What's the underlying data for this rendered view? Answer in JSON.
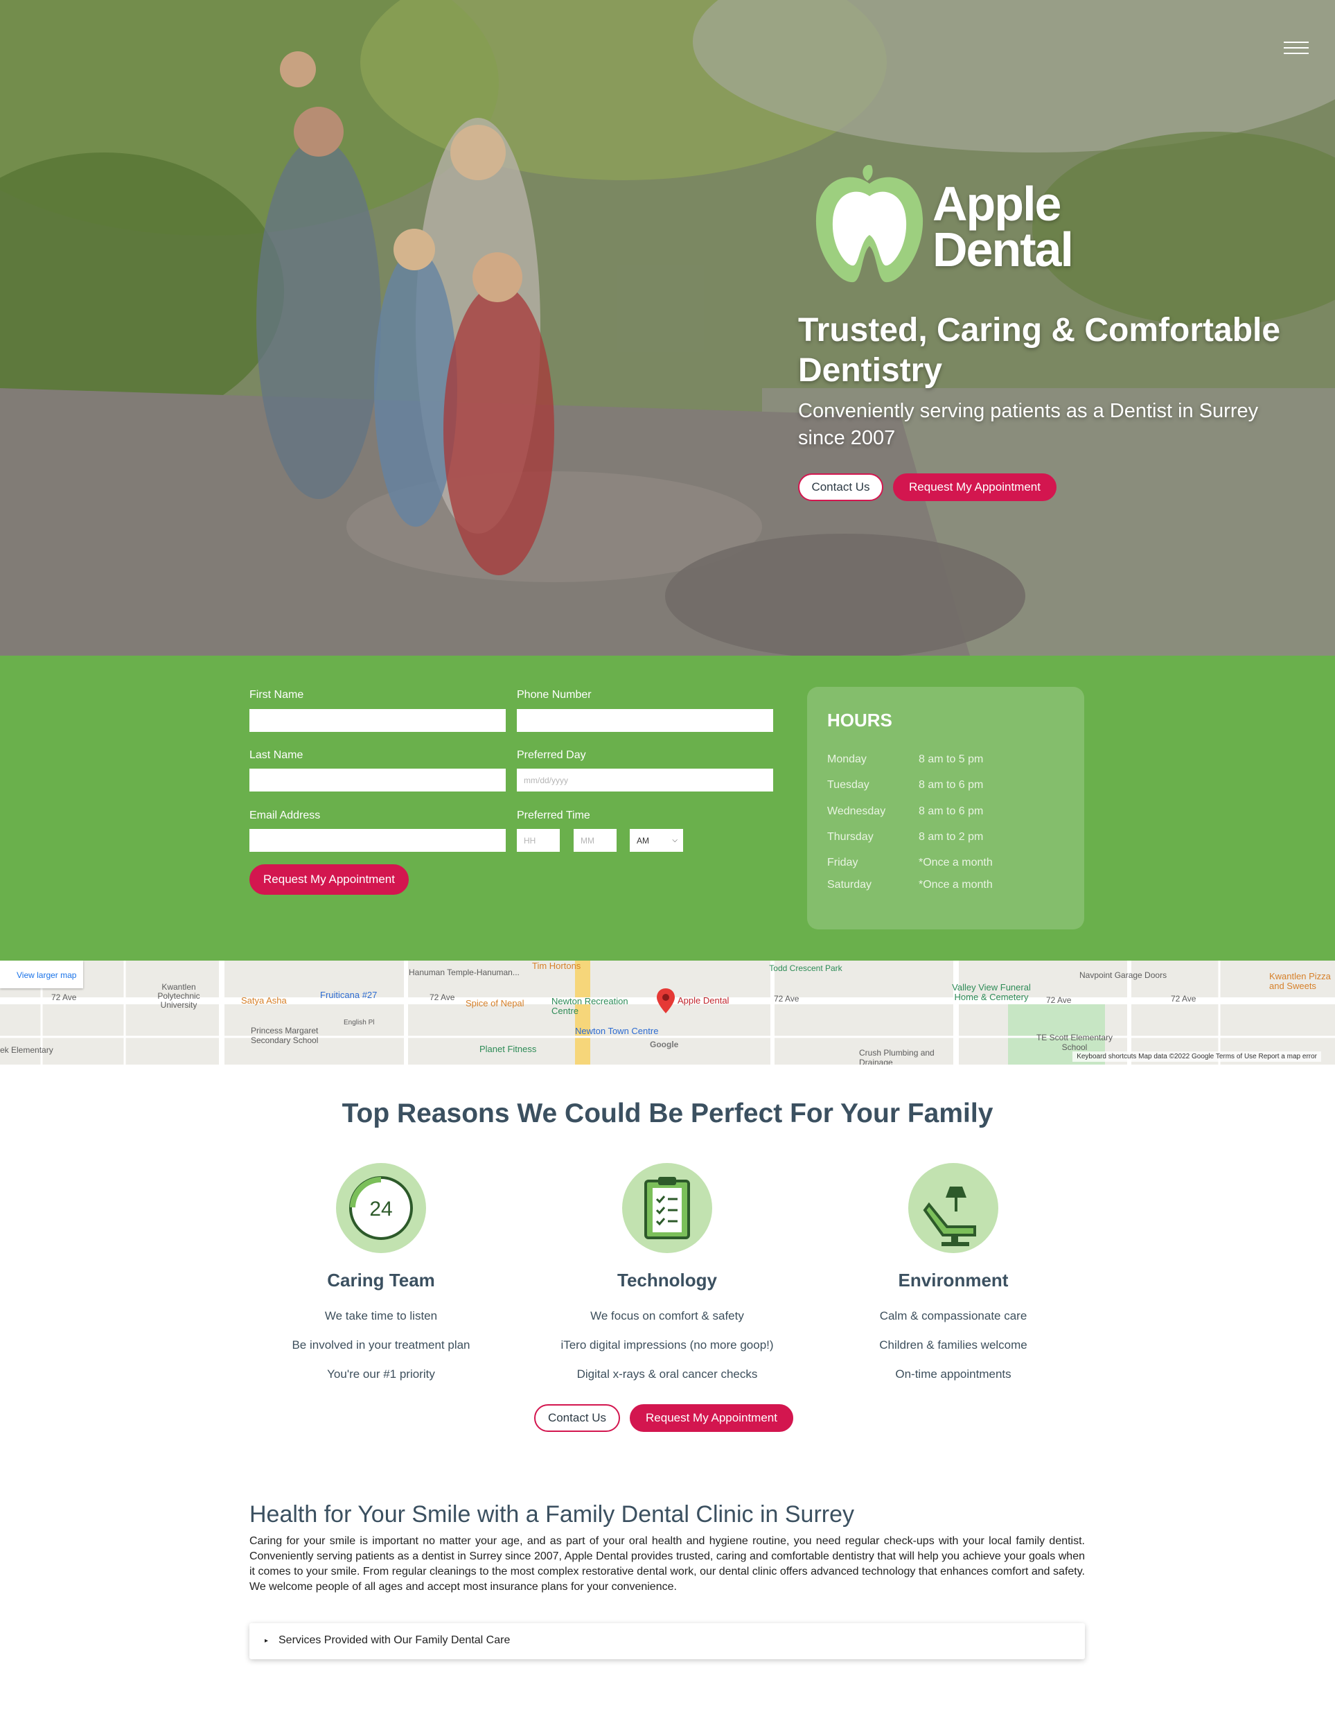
{
  "hero": {
    "logo_line1": "Apple",
    "logo_line2": "Dental",
    "title": "Trusted, Caring & Comfortable Dentistry",
    "subtitle": "Conveniently serving patients as a Dentist in Surrey since 2007",
    "contact_label": "Contact Us",
    "request_label": "Request My Appointment"
  },
  "form": {
    "first_name_label": "First Name",
    "phone_label": "Phone Number",
    "last_name_label": "Last Name",
    "preferred_day_label": "Preferred Day",
    "preferred_day_placeholder": "mm/dd/yyyy",
    "email_label": "Email Address",
    "preferred_time_label": "Preferred Time",
    "hour_placeholder": "HH",
    "minute_placeholder": "MM",
    "ampm_value": "AM",
    "submit_label": "Request My Appointment"
  },
  "hours": {
    "title": "HOURS",
    "rows": [
      {
        "day": "Monday",
        "time": "8 am to 5 pm"
      },
      {
        "day": "Tuesday",
        "time": "8 am to 6 pm"
      },
      {
        "day": "Wednesday",
        "time": "8 am to 6 pm"
      },
      {
        "day": "Thursday",
        "time": "8 am to 2 pm"
      },
      {
        "day": "Friday",
        "time": "*Once a month"
      },
      {
        "day": "Saturday",
        "time": "*Once a month"
      }
    ]
  },
  "map": {
    "view_larger": "View larger map",
    "pin_label": "Apple Dental",
    "labels": {
      "ave72": "72 Ave",
      "kwantlen": "Kwantlen Polytechnic University",
      "satya": "Satya Asha",
      "fruiticana": "Fruiticana #27",
      "hanuman": "Hanuman Temple-Hanuman...",
      "tim": "Tim Hortons",
      "spice": "Spice of Nepal",
      "newton_rec": "Newton Recreation Centre",
      "newton_town": "Newton Town Centre",
      "planet": "Planet Fitness",
      "todd": "Todd Crescent Park",
      "valley": "Valley View Funeral Home & Cemetery",
      "navpoint": "Navpoint Garage Doors",
      "kwantlen_pizza": "Kwantlen Pizza and Sweets",
      "te_scott": "TE Scott Elementary School",
      "crush": "Crush Plumbing and Drainage",
      "princess": "Princess Margaret Secondary School",
      "ek_elem": "ek Elementary",
      "english_pl": "English Pl",
      "google": "Google",
      "footer": "Keyboard shortcuts   Map data ©2022 Google   Terms of Use   Report a map error"
    }
  },
  "reasons": {
    "title": "Top Reasons We Could Be Perfect For Your Family",
    "items": [
      {
        "title": "Caring Team",
        "lines": [
          "We take time to listen",
          "Be involved in your treatment plan",
          "You're our #1 priority"
        ],
        "icon_text": "24"
      },
      {
        "title": "Technology",
        "lines": [
          "We focus on comfort & safety",
          "iTero digital impressions (no more goop!)",
          "Digital x-rays & oral cancer checks"
        ]
      },
      {
        "title": "Environment",
        "lines": [
          "Calm & compassionate care",
          "Children & families welcome",
          "On-time appointments"
        ]
      }
    ],
    "contact_label": "Contact Us",
    "request_label": "Request My Appointment"
  },
  "health": {
    "title": "Health for Your Smile with a Family Dental Clinic in Surrey",
    "body": "Caring for your smile is important no matter your age, and as part of your oral health and hygiene routine, you need regular check-ups with your local family dentist. Conveniently serving patients as a dentist in Surrey since 2007, Apple Dental provides trusted, caring and comfortable dentistry that will help you achieve your goals when it comes to your smile. From regular cleanings to the most complex restorative dental work, our dental clinic offers advanced technology that enhances comfort and safety. We welcome people of all ages and accept most insurance plans for your convenience.",
    "accordion_label": "Services Provided with Our Family Dental Care"
  },
  "colors": {
    "brand_green": "#6ab04c",
    "accent_red": "#d3164f",
    "heading_slate": "#3b5060",
    "icon_circle": "#c2e2b0"
  }
}
